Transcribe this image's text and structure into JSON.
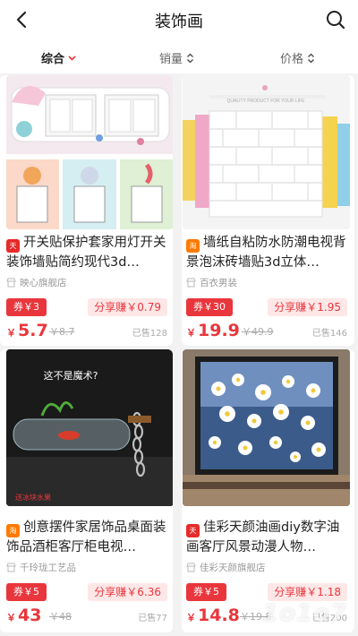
{
  "header": {
    "title": "装饰画",
    "back_icon": "back-arrow-icon",
    "search_icon": "search-icon"
  },
  "sort": {
    "items": [
      {
        "label": "综合",
        "active": true
      },
      {
        "label": "销量",
        "active": false
      },
      {
        "label": "价格",
        "active": false
      }
    ]
  },
  "products": [
    {
      "badge": "tmall",
      "title": "开关贴保护套家用灯开关装饰墙贴简约现代3d…",
      "shop": "映心旗舰店",
      "coupon": "券￥3",
      "share": "分享赚￥0.79",
      "price_symbol": "￥",
      "price": "5.7",
      "original_price": "￥8.7",
      "sold": "已售128"
    },
    {
      "badge": "taobao",
      "title": "墙纸自粘防水防潮电视背景泡沫砖墙贴3d立体…",
      "shop": "百衣男装",
      "coupon": "券￥30",
      "share": "分享赚￥1.95",
      "price_symbol": "￥",
      "price": "19.9",
      "original_price": "￥49.9",
      "sold": "已售146",
      "image_caption": "QUALITY PRODUCT FOR YOUR LIFE"
    },
    {
      "badge": "taobao",
      "title": "创意摆件家居饰品桌面装饰品酒柜客厅柜电视…",
      "shop": "千玲珑工艺品",
      "coupon": "券￥5",
      "share": "分享赚￥6.36",
      "price_symbol": "￥",
      "price": "43",
      "original_price": "￥48",
      "sold": "已售77",
      "image_caption": "这不是魔术?",
      "image_tag": "送冰块水果"
    },
    {
      "badge": "tmall",
      "title": "佳彩天颜油画diy数字油画客厅风景动漫人物…",
      "shop": "佳彩天颜旗舰店",
      "coupon": "券￥5",
      "share": "分享赚￥1.18",
      "price_symbol": "￥",
      "price": "14.8",
      "original_price": "￥19.8",
      "sold": "已售200"
    }
  ],
  "watermark": "1o1o7",
  "colors": {
    "accent": "#e9363c",
    "tmall": "#e62a2a",
    "taobao": "#ff7a00"
  }
}
